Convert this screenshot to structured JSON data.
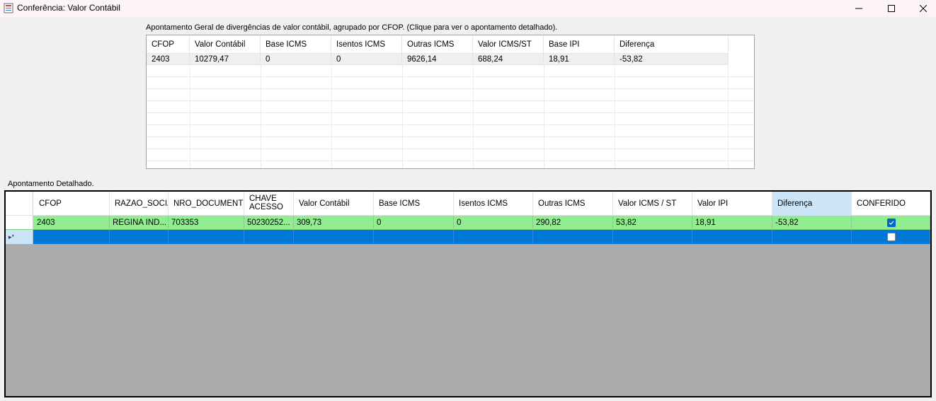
{
  "window": {
    "title": "Conferência: Valor Contábil",
    "minimize_glyph": "—",
    "maximize_glyph": "☐",
    "close_glyph": "✕"
  },
  "summary": {
    "caption": "Apontamento Geral de divergências de valor contábil, agrupado por CFOP.  (Clique para ver o apontamento detalhado).",
    "columns": [
      "CFOP",
      "Valor Contábil",
      "Base ICMS",
      "Isentos ICMS",
      "Outras ICMS",
      "Valor ICMS/ST",
      "Base IPI",
      "Diferença"
    ],
    "rows": [
      [
        "2403",
        "10279,47",
        "0",
        "0",
        "9626,14",
        "688,24",
        "18,91",
        "-53,82"
      ]
    ]
  },
  "detail": {
    "caption": "Apontamento Detalhado.",
    "columns": [
      "CFOP",
      "RAZAO_SOCIAL",
      "NRO_DOCUMENTO",
      "CHAVE ACESSO",
      "Valor Contábil",
      "Base ICMS",
      "Isentos ICMS",
      "Outras ICMS",
      "Valor ICMS / ST",
      "Valor IPI",
      "Diferença",
      "CONFERIDO"
    ],
    "column_display": [
      "CFOP",
      "RAZAO_SOCIA",
      "NRO_DOCUMENTC",
      "CHAVE\nACESSO",
      "Valor Contábil",
      "Base ICMS",
      "Isentos ICMS",
      "Outras ICMS",
      "Valor ICMS / ST",
      "Valor IPI",
      "Diferença",
      "CONFERIDO"
    ],
    "rows": [
      {
        "cells": [
          "2403",
          "REGINA IND...",
          "703353",
          "50230252...",
          "309,73",
          "0",
          "0",
          "290,82",
          "53,82",
          "18,91",
          "-53,82"
        ],
        "conferido": true
      }
    ],
    "new_row_marker": "▸*",
    "new_row_conferido": false
  },
  "colors": {
    "row_ok": "#90ee90",
    "row_selected": "#0078d7",
    "sorted_header": "#cce4f7",
    "empty_area": "#ababab"
  }
}
